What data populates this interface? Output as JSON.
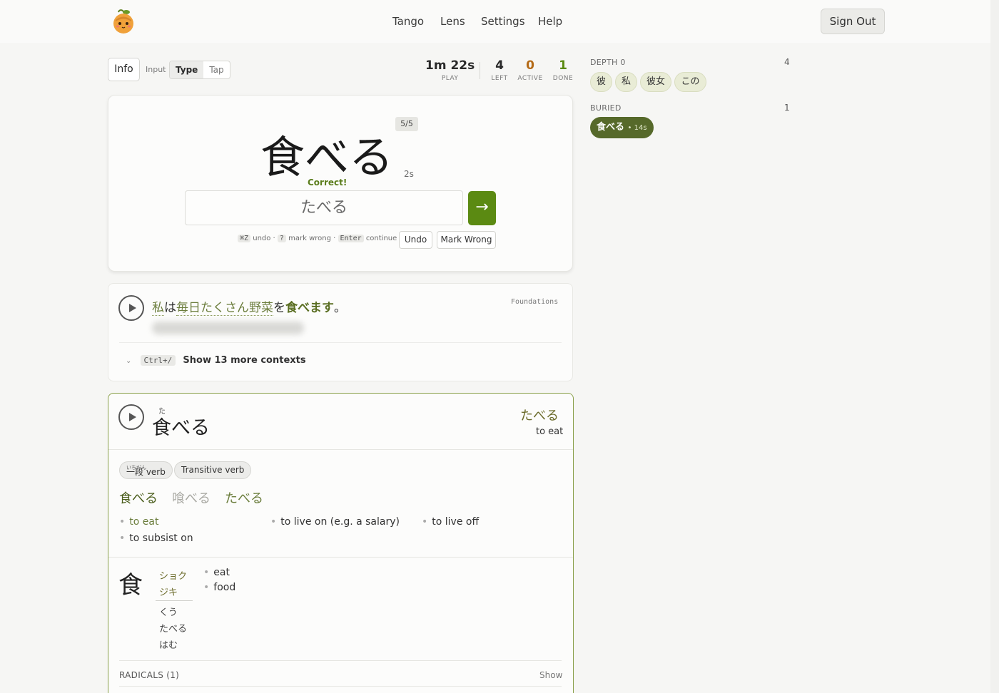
{
  "header": {
    "nav": [
      "Tango",
      "Lens",
      "Settings",
      "Help"
    ],
    "sign_out": "Sign Out"
  },
  "toolbar": {
    "info": "Info",
    "input_label": "Input",
    "input_modes": [
      "Type",
      "Tap"
    ],
    "selected_mode": "Type"
  },
  "stats": {
    "play": {
      "value": "1m 22s",
      "label": "PLAY"
    },
    "left": {
      "value": "4",
      "label": "LEFT"
    },
    "active": {
      "value": "0",
      "label": "ACTIVE"
    },
    "done": {
      "value": "1",
      "label": "DONE"
    }
  },
  "review": {
    "progress": "5/5",
    "prompt": "食べる",
    "timer": "2s",
    "feedback": "Correct!",
    "answer": "たべる",
    "submit_icon": "→",
    "hint_undo_key": "⌘Z",
    "hint_undo": "undo ·",
    "hint_wrong_key": "?",
    "hint_wrong": "mark wrong ·",
    "hint_continue_key": "Enter",
    "hint_continue": "continue",
    "undo_button": "Undo",
    "mark_wrong_button": "Mark Wrong"
  },
  "context": {
    "source": "Foundations",
    "shortcut": "Ctrl+/",
    "more_label": "Show 13 more contexts",
    "sentence": {
      "k1": "私",
      "p1": "は",
      "k2": "毎日たくさん野菜",
      "p2": "を",
      "target": "食べます",
      "end": "。"
    }
  },
  "entry": {
    "furigana": "た",
    "word": "食べる",
    "kana": "たべる",
    "gloss": "to eat",
    "tags": [
      "一段 verb",
      "Transitive verb"
    ],
    "tag_ruby": "いちだん",
    "forms": [
      "食べる",
      "喰べる",
      "たべる"
    ],
    "meanings": [
      "to eat",
      "to live on (e.g. a salary)",
      "to live off",
      "to subsist on"
    ],
    "kanji": {
      "char": "食",
      "on": [
        "ショク",
        "ジキ"
      ],
      "kun": [
        "くう",
        "たべる",
        "はむ"
      ],
      "meanings": [
        "eat",
        "food"
      ]
    },
    "radicals_label": "RADICALS (1)",
    "radicals_show": "Show"
  },
  "queue": {
    "depth_label": "DEPTH 0",
    "depth_count": "4",
    "depth_items": [
      "彼",
      "私",
      "彼女",
      "この"
    ],
    "buried_label": "BURIED",
    "buried_count": "1",
    "buried_word": "食べる",
    "buried_time": "• 14s"
  },
  "colors": {
    "accent": "#5b8a12",
    "accent_dark": "#56692a",
    "kana_text": "#6b6b2a"
  }
}
